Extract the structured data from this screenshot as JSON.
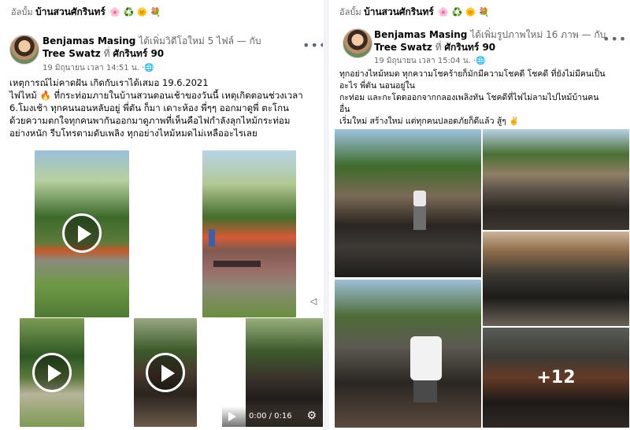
{
  "left": {
    "album_label": "อัลบั้ม",
    "album_name": "บ้านสวนศักรินทร์",
    "album_emoji": "🌸 ♻️ 🌞 💐",
    "poster_name": "Benjamas Masing",
    "action_text": "ได้เพิ่มวิดีโอใหม่ 5 ไฟล์ — กับ",
    "tag1": "Tree Swatz",
    "at_word": "ที่",
    "place": "ศักรินทร์ 90",
    "timestamp": "19 มิถุนายน เวลา 14:51 น.",
    "more_icon": "more-dots-icon",
    "globe_icon": "globe-icon",
    "text_lines": [
      "เหตุการณ์ไม่คาดฝัน เกิดกับเราได้เสมอ 19.6.2021",
      "ไฟไหม้ 🔥 ที่กระท่อมภายในบ้านสวนตอนเช้าของวันนี้ เหตุเกิดตอนช่วงเวลา",
      "6.โมงเช้า ทุกคนนอนหลับอยู่ พี่ตัน ก็มา เดาะห้อง พี่ๆๆ ออกมาดูพี่ ตะโกน",
      "ด้วยความตกใจทุกคนพากันออกมาดูภาพที่เห็นคือไฟกำลังลุกไหม้กระท่อม",
      "อย่างหนัก รีบโทรตามดับเพลิง ทุกอย่างไหม้หมดไม่เหลืออะไรเลย"
    ],
    "video_time": "0:00 / 0:16"
  },
  "right": {
    "album_label": "อัลบั้ม",
    "album_name": "บ้านสวนศักรินทร์",
    "album_emoji": "🌸 ♻️ 🌞 💐",
    "poster_name": "Benjamas Masing",
    "action_text": "ได้เพิ่มรูปภาพใหม่ 16 ภาพ — กับ",
    "tag1": "Tree Swatz",
    "at_word": "ที่",
    "place": "ศักรินทร์ 90",
    "timestamp": "19 มิถุนายน เวลา 15:04 น.",
    "text_lines": [
      "ทุกอย่างไหม้หมด ทุกความโชคร้ายก็มักมีความโชคดี โชคดี ที่ยังไม่มีคนเป็น",
      "อะไร พี่ตัน นอนอยู่ใน",
      "กะท่อม และกะโดดออกจากกลองเพลิงทัน โชคดีที่ไฟไม่ลามไปไหม้บ้านคน",
      "อื่น",
      "เริ่มใหม่ สร้างใหม่ แต่ทุกคนปลอดภัยก็ดีแล้ว สู้ๆ ✌️"
    ],
    "more_count": "+12"
  },
  "colors": {
    "text": "#050505",
    "muted": "#65676b",
    "divider": "#f0f2f5"
  }
}
